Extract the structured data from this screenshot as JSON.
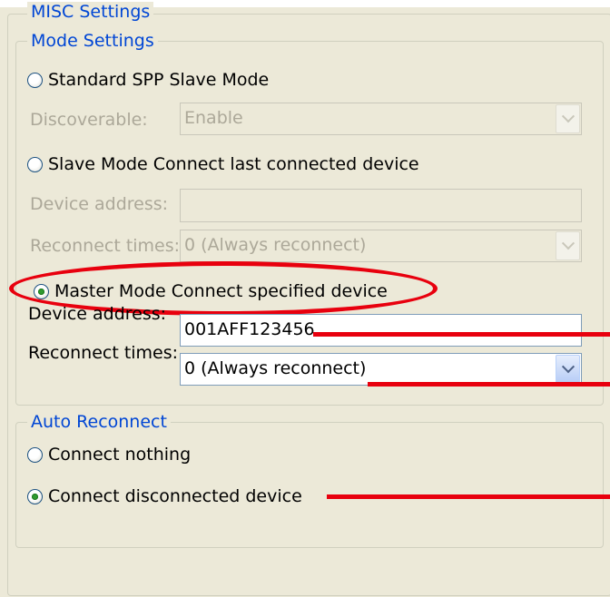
{
  "misc_group": {
    "legend": "MISC Settings"
  },
  "mode_group": {
    "legend": "Mode Settings",
    "standard": {
      "label": "Standard SPP Slave Mode",
      "checked": false,
      "discoverable_label": "Discoverable:",
      "discoverable_value": "Enable"
    },
    "slave_last": {
      "label": "Slave Mode Connect last connected device",
      "checked": false,
      "device_address_label": "Device address:",
      "device_address_value": "",
      "reconnect_label": "Reconnect times:",
      "reconnect_value": "0 (Always reconnect)"
    },
    "master": {
      "label": "Master Mode Connect specified device",
      "checked": true,
      "device_address_label": "Device address:",
      "device_address_value": "001AFF123456",
      "reconnect_label": "Reconnect times:",
      "reconnect_value": "0 (Always reconnect)"
    }
  },
  "auto_group": {
    "legend": "Auto Reconnect",
    "options": [
      {
        "label": "Connect nothing",
        "checked": false
      },
      {
        "label": "Connect disconnected device",
        "checked": true
      }
    ]
  },
  "colors": {
    "annotation": "#E8000E",
    "legend_text": "#0046D5",
    "panel_bg": "#ECE9D8"
  }
}
